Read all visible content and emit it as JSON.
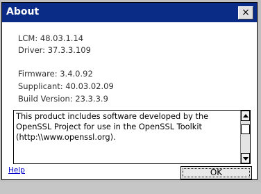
{
  "dialog": {
    "title": "About",
    "close_label": "×"
  },
  "info": {
    "lcm": "LCM: 48.03.1.14",
    "driver": "Driver: 37.3.3.109",
    "firmware": "Firmware: 3.4.0.92",
    "supplicant": "Supplicant: 40.03.02.09",
    "build_version": "Build Version: 23.3.3.9"
  },
  "notice": {
    "line1": "This product includes software developed by the",
    "line2": "OpenSSL Project for use in the OpenSSL Toolkit",
    "line3": "(http:\\\\www.openssl.org)."
  },
  "footer": {
    "help_label": "Help",
    "ok_label": "OK"
  },
  "colors": {
    "titlebar": "#0a2c86",
    "link": "#0000cc"
  }
}
